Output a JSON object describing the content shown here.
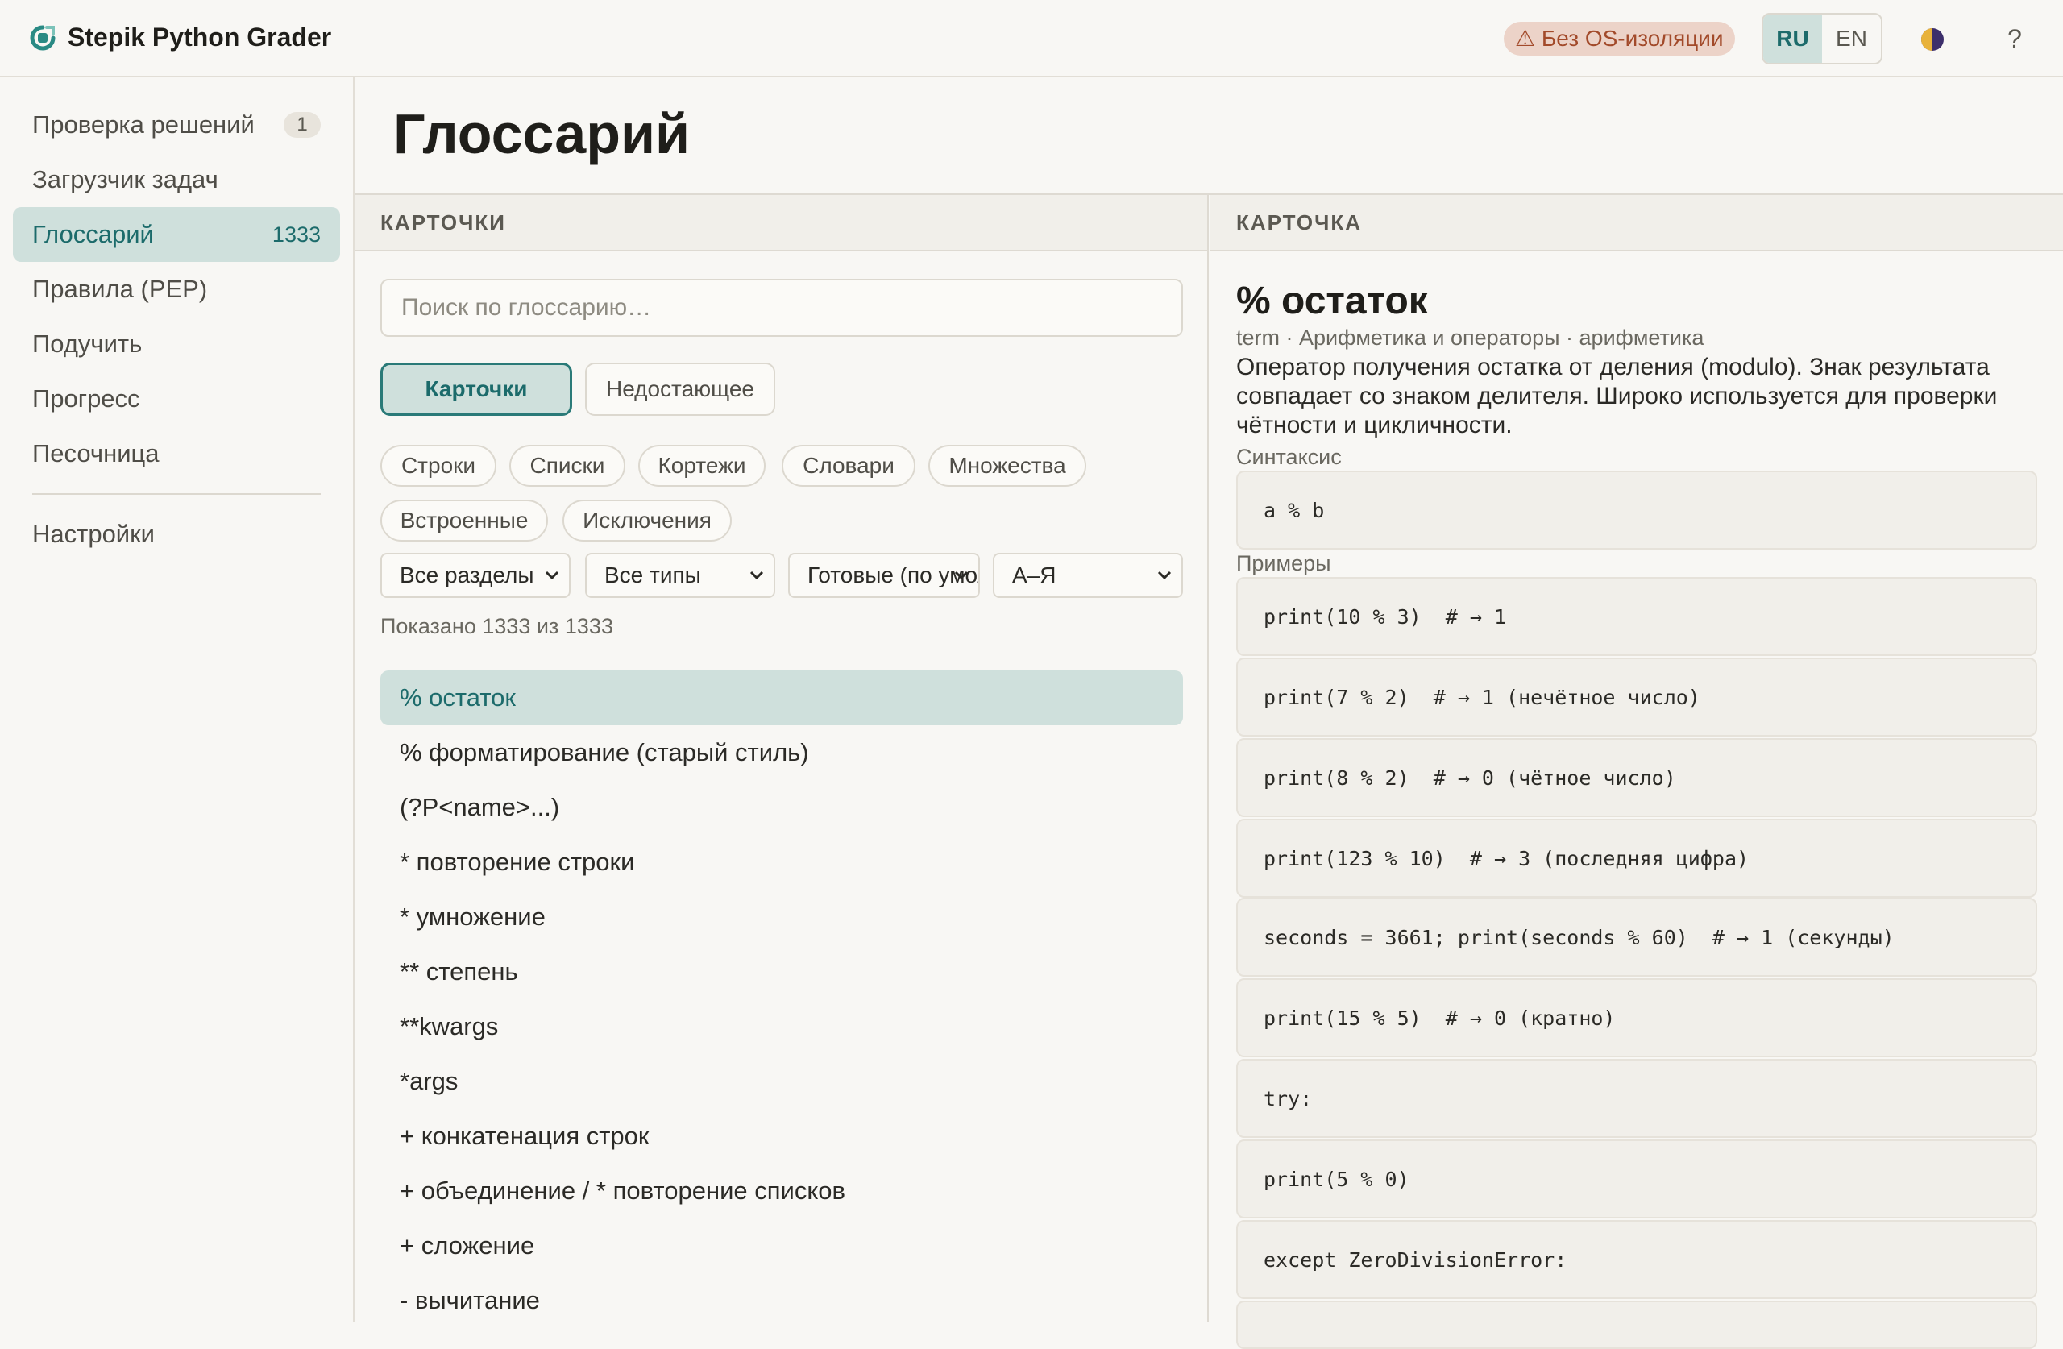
{
  "app": {
    "title": "Stepik Python Grader",
    "warning_badge": "⚠ Без OS-изоляции",
    "languages": [
      "RU",
      "EN"
    ],
    "active_language": "RU",
    "help_label": "?",
    "accent_color": "#1c6b6b"
  },
  "sidebar": {
    "items": [
      {
        "label": "Проверка решений",
        "count": "1"
      },
      {
        "label": "Загрузчик задач",
        "count": ""
      },
      {
        "label": "Глоссарий",
        "count": "1333"
      },
      {
        "label": "Правила (PEP)",
        "count": ""
      },
      {
        "label": "Подучить",
        "count": ""
      },
      {
        "label": "Прогресс",
        "count": ""
      },
      {
        "label": "Песочница",
        "count": ""
      }
    ],
    "active_item": "Глоссарий",
    "settings_label": "Настройки"
  },
  "page": {
    "title": "Глоссарий"
  },
  "cards_panel": {
    "header": "КАРТОЧКИ",
    "search_placeholder": "Поиск по глоссарию…",
    "search_value": "",
    "modes": [
      "Карточки",
      "Недостающее"
    ],
    "active_mode": "Карточки",
    "chips": [
      "Строки",
      "Списки",
      "Кортежи",
      "Словари",
      "Множества",
      "Встроенные",
      "Исключения"
    ],
    "filters": [
      "Все разделы",
      "Все типы",
      "Готовые (по умолчанию)",
      "А–Я"
    ],
    "shown_text": "Показано 1333 из 1333",
    "terms": [
      "% остаток",
      "% форматирование (старый стиль)",
      "(?P<name>...)",
      "* повторение строки",
      "* умножение",
      "** степень",
      "**kwargs",
      "*args",
      "+ конкатенация строк",
      "+ объединение / * повторение списков",
      "+ сложение",
      "- вычитание"
    ],
    "active_term": "% остаток"
  },
  "card_panel": {
    "header": "КАРТОЧКА",
    "title": "% остаток",
    "meta": "term · Арифметика и операторы · арифметика",
    "description": "Оператор получения остатка от деления (modulo). Знак результата совпадает со знаком делителя. Широко используется для проверки чётности и цикличности.",
    "syntax_label": "Синтаксис",
    "syntax": "a % b",
    "examples_label": "Примеры",
    "examples": [
      "print(10 % 3)  # → 1",
      "print(7 % 2)  # → 1 (нечётное число)",
      "print(8 % 2)  # → 0 (чётное число)",
      "print(123 % 10)  # → 3 (последняя цифра)",
      "seconds = 3661; print(seconds % 60)  # → 1 (секунды)",
      "print(15 % 5)  # → 0 (кратно)",
      "try:",
      "print(5 % 0)",
      "except ZeroDivisionError:"
    ]
  }
}
